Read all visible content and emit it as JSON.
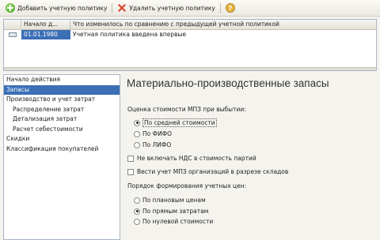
{
  "toolbar": {
    "add_label": "Добавить учетную политику",
    "delete_label": "Удалить учетную политику",
    "help_symbol": "?"
  },
  "grid": {
    "columns": [
      "Начало д...",
      "Что изменилось по сравнению с предыдущей учетной политикой"
    ],
    "rows": [
      {
        "date": "01.01.1980",
        "text": "Учетная политика введена впервые"
      }
    ]
  },
  "nav": {
    "items": [
      "Начало действия",
      "Запасы",
      "Производство и учет затрат",
      "Распределение затрат",
      "Детализация затрат",
      "Расчет себестоимости",
      "Скидки",
      "Классификация покупателей"
    ],
    "active_index": 1
  },
  "panel": {
    "title": "Материально-производственные запасы",
    "valuation_label": "Оценка стоимости МПЗ при выбытии:",
    "valuation_options": [
      "По средней стоимости",
      "По ФИФО",
      "По ЛИФО"
    ],
    "valuation_selected": 0,
    "vat_checkbox": "Не включать НДС в стоимость партий",
    "warehouse_checkbox": "Вести учет МПЗ организаций в разрезе складов",
    "order_label": "Порядок формирования учетных цен:",
    "order_options": [
      "По плановым ценам",
      "По прямым затратам",
      "По нулевой стоимости"
    ],
    "order_selected": 1
  },
  "colors": {
    "selection": "#3b6fb6",
    "background": "#f4f3ee",
    "add_icon": "#3c9a1e",
    "delete_icon": "#d9412a"
  }
}
